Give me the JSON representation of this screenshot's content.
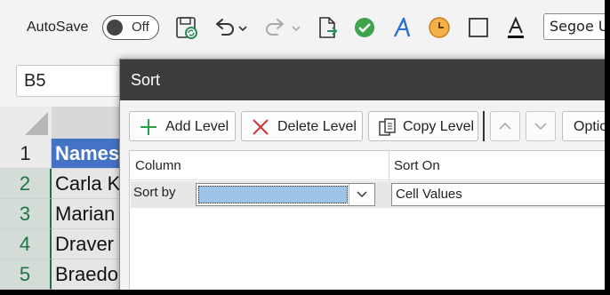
{
  "ribbon": {
    "autosave_label": "AutoSave",
    "autosave_state": "Off",
    "font_name": "Segoe U",
    "icons": [
      "save-icon",
      "undo-icon",
      "undo-dropdown-icon",
      "redo-icon",
      "redo-dropdown-icon",
      "export-icon",
      "check-icon",
      "ink-icon",
      "clock-icon",
      "border-icon",
      "font-color-icon"
    ]
  },
  "namebox": {
    "value": "B5"
  },
  "sheet": {
    "rows": [
      {
        "num": "1",
        "value": "Names"
      },
      {
        "num": "2",
        "value": "Carla K"
      },
      {
        "num": "3",
        "value": "Marian"
      },
      {
        "num": "4",
        "value": "Draver"
      },
      {
        "num": "5",
        "value": "Braedo"
      }
    ]
  },
  "dialog": {
    "title": "Sort",
    "add_level": "Add Level",
    "delete_level": "Delete Level",
    "copy_level": "Copy Level",
    "options": "Optio",
    "column_header": "Column",
    "sort_on_header": "Sort On",
    "sort_by_label": "Sort by",
    "sort_by_value": "",
    "sort_on_value": "Cell Values"
  },
  "colors": {
    "accent_green": "#217346",
    "header_blue": "#4472c4",
    "selection_blue": "#9dc3e6",
    "titlebar": "#3d3d3d"
  }
}
